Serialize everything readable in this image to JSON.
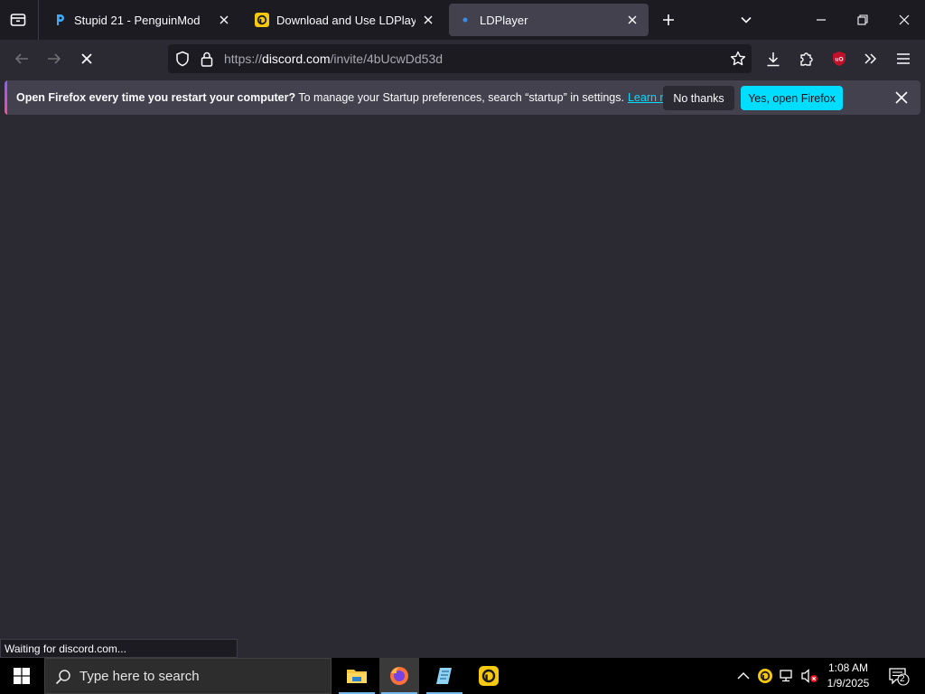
{
  "tabs": [
    {
      "title": "Stupid 21 - PenguinMod",
      "active": false
    },
    {
      "title": "Download and Use LDPlayer on",
      "active": false
    },
    {
      "title": "LDPlayer",
      "active": true
    }
  ],
  "urlbar": {
    "scheme": "https://",
    "host": "discord.com",
    "path": "/invite/4bUcwDd53d"
  },
  "notification": {
    "bold": "Open Firefox every time you restart your computer?",
    "text": " To manage your Startup preferences, search “startup” in settings.",
    "link": "Learn more",
    "no_label": "No thanks",
    "yes_label": "Yes, open Firefox"
  },
  "status": "Waiting for discord.com...",
  "taskbar": {
    "search_placeholder": "Type here to search",
    "time": "1:08 AM",
    "date": "1/9/2025",
    "notification_count": "2"
  },
  "colors": {
    "accent": "#00ddff",
    "chrome_dark": "#1c1b22",
    "content_bg": "#2b2a33"
  }
}
